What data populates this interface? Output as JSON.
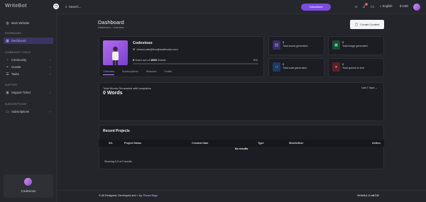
{
  "app": {
    "name": "WriteBot"
  },
  "sidebar": {
    "main_website": "Main Website",
    "sections": [
      {
        "title": "DASHBOARD",
        "items": [
          {
            "label": "Dashboard"
          }
        ]
      },
      {
        "title": "COMMUNITY TOOLS",
        "items": [
          {
            "label": "Community"
          },
          {
            "label": "Guests"
          },
          {
            "label": "Tasks"
          }
        ]
      },
      {
        "title": "SUPPORT",
        "items": [
          {
            "label": "Support Ticket"
          }
        ]
      },
      {
        "title": "SUBSCRIPTIONS",
        "items": [
          {
            "label": "Subscriptions"
          }
        ]
      }
    ],
    "user_name": "Codevioso"
  },
  "topbar": {
    "search_placeholder": "Search...",
    "upgrade_label": "Subscribers",
    "notification_count": "1",
    "language": "English",
    "currency": "$ USD"
  },
  "header": {
    "title": "Dashboard",
    "breadcrumb": "Dashboard  >  Overview",
    "create_button": "Create Content"
  },
  "profile": {
    "name": "Codevioso",
    "email": "democrate@tbo@mailinator.com",
    "words_prefix": "Used out of",
    "words_used": "0",
    "words_total": "1000",
    "words_suffix": "Words",
    "percent": "0%",
    "progress": 0,
    "tabs": [
      "Overview",
      "Subscriptions",
      "Histories",
      "Profile"
    ]
  },
  "stats": [
    {
      "value": "0",
      "label": "Total words generated",
      "icon": "file-text-icon",
      "color": "#8b5cf6"
    },
    {
      "value": "0",
      "label": "Total image generated",
      "icon": "image-icon",
      "color": "#22c55e"
    },
    {
      "value": "0",
      "label": "Total code generated",
      "icon": "code-icon",
      "color": "#3b82f6"
    },
    {
      "value": "0",
      "label": "Total speech to text",
      "icon": "microphone-icon",
      "color": "#ef4444"
    }
  ],
  "template_words": {
    "title": "Total Words Generated with templates",
    "value": "0 Words",
    "range": "Last 7 days"
  },
  "recent_projects": {
    "title": "Recent Projects",
    "columns": [
      "S/L",
      "Project Name",
      "Created Date",
      "Type",
      "Words/Size",
      "Action"
    ],
    "empty": "No results",
    "showing": "Showing 0-0 of 0 results"
  },
  "footer": {
    "left_prefix": "© All Designed, Developed and",
    "left_by": "by",
    "brand": "ThemeTags",
    "right_name": "WriteBot AI",
    "version": "v4.7.0"
  }
}
